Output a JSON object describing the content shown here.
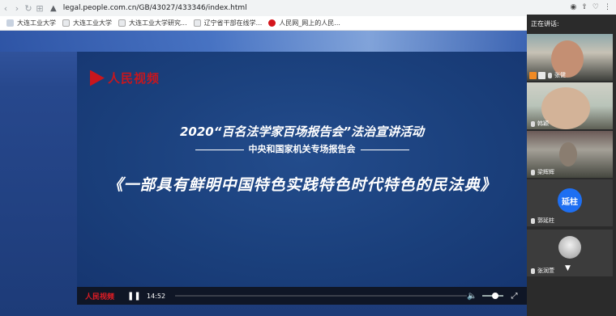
{
  "browser": {
    "url": "legal.people.com.cn/GB/43027/433346/index.html",
    "bookmarks": [
      {
        "label": "大连工业大学"
      },
      {
        "label": "大连工业大学"
      },
      {
        "label": "大连工业大学研究..."
      },
      {
        "label": "辽宁省干部在线学..."
      },
      {
        "label": "人民网_网上的人民..."
      }
    ]
  },
  "video": {
    "logo_text": "人民视频",
    "title_line1": "2020“百名法学家百场报告会”法治宣讲活动",
    "title_line2": "中央和国家机关专场报告会",
    "title_line3": "《一部具有鲜明中国特色实践特色时代特色的民法典》",
    "controls": {
      "logo_text": "人民视频",
      "time": "14:52",
      "play_icon": "pause-icon"
    }
  },
  "meeting": {
    "speaking_label": "正在讲话:",
    "participants": [
      {
        "name": "张健"
      },
      {
        "name": "韩颖"
      },
      {
        "name": "梁辉辉"
      },
      {
        "name": "郭延柱",
        "avatar_text": "延柱"
      },
      {
        "name": "张润萱"
      }
    ]
  },
  "colors": {
    "accent_red": "#c8161d",
    "avatar_blue": "#1e6ff2",
    "player_bg": "#1d4480"
  }
}
